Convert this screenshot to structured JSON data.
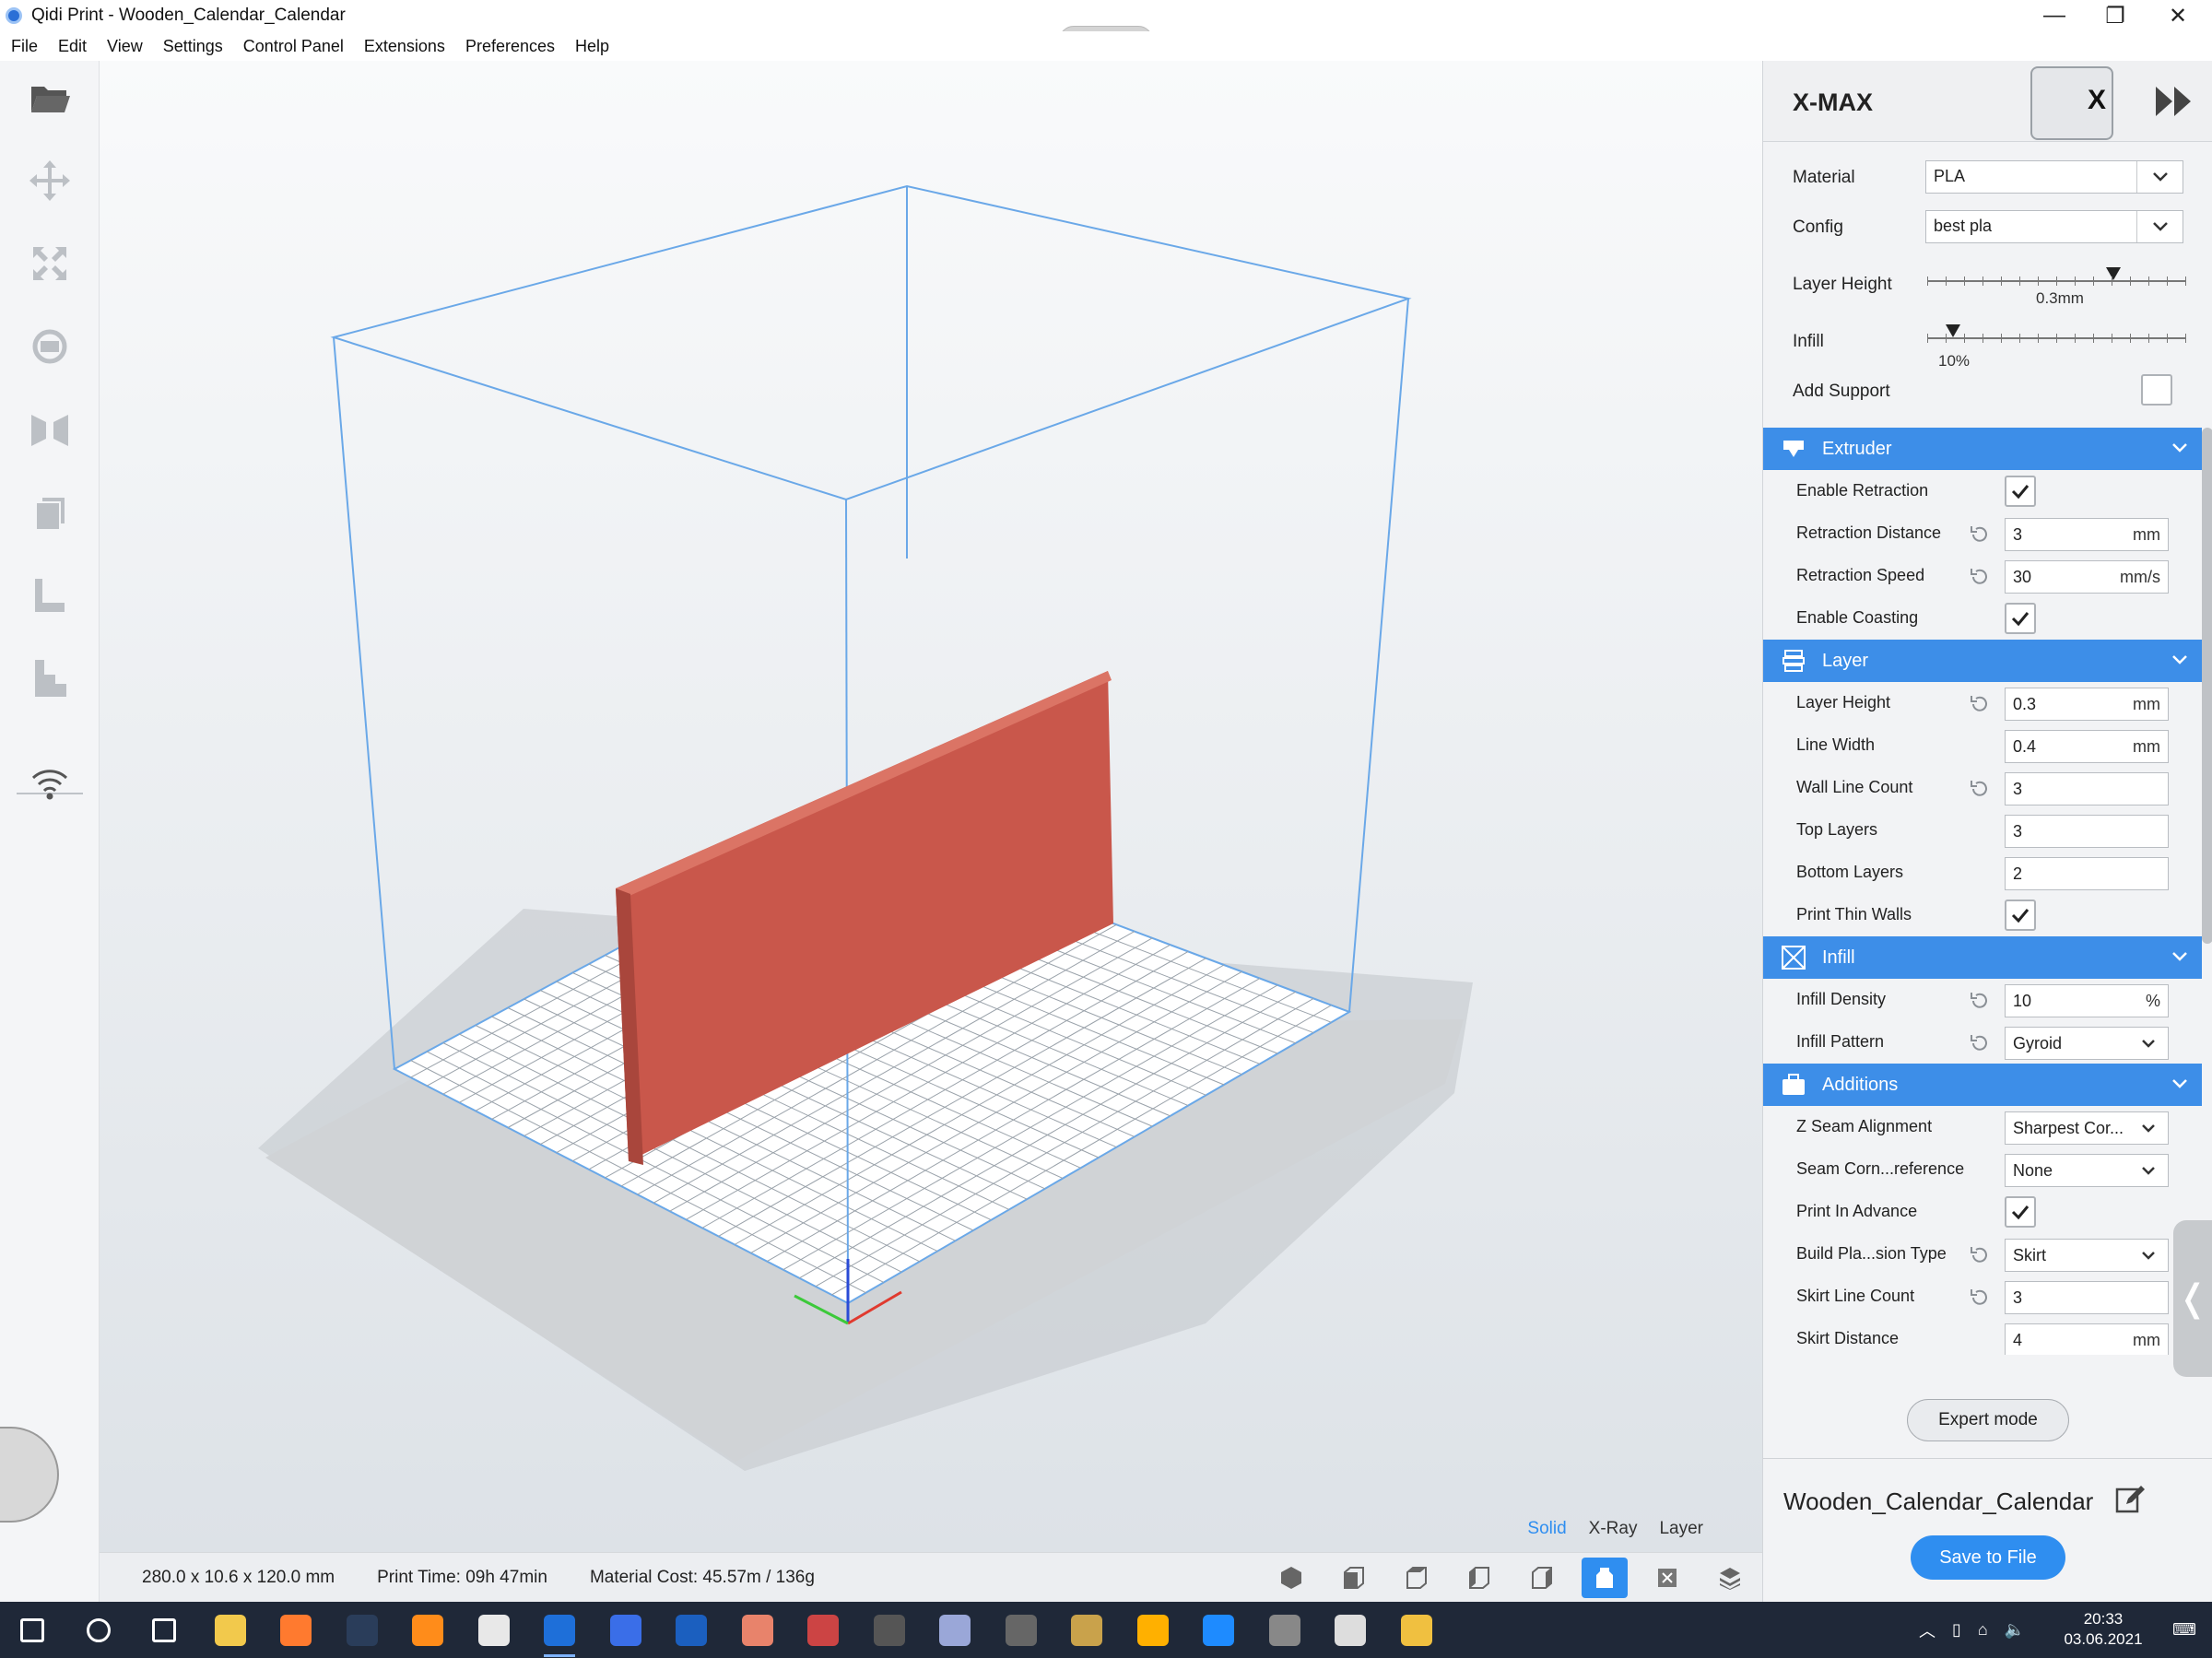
{
  "window": {
    "title": "Qidi Print - Wooden_Calendar_Calendar",
    "controls": {
      "minimize": "—",
      "restore": "❐",
      "close": "✕"
    }
  },
  "menu": [
    "File",
    "Edit",
    "View",
    "Settings",
    "Control Panel",
    "Extensions",
    "Preferences",
    "Help"
  ],
  "left_toolbar": [
    "open-file-icon",
    "move-icon",
    "scale-icon",
    "rotate-icon",
    "mirror-icon",
    "per-model-settings-icon",
    "support-blocker-icon",
    "support-icon",
    "wifi-icon"
  ],
  "viewport": {
    "view_modes": [
      {
        "label": "Solid",
        "active": true
      },
      {
        "label": "X-Ray",
        "active": false
      },
      {
        "label": "Layer",
        "active": false
      }
    ],
    "object_color": "#c9574b",
    "frame_color": "#6aa8e8"
  },
  "status": {
    "dimensions": "280.0 x 10.6 x 120.0 mm",
    "print_time": "Print Time: 09h 47min",
    "material_cost": "Material Cost: 45.57m / 136g"
  },
  "camera_views": [
    "3d-view-icon",
    "front-view-icon",
    "top-view-icon",
    "left-view-icon",
    "right-view-icon",
    "active-view-icon",
    "xray-view-icon",
    "layer-view-icon"
  ],
  "panel": {
    "printer": "X-MAX",
    "printer_badge": "X",
    "material_label": "Material",
    "material_value": "PLA",
    "config_label": "Config",
    "config_value": "best pla",
    "layer_height_label": "Layer Height",
    "layer_height_value": "0.3mm",
    "layer_height_fraction": 0.72,
    "infill_label": "Infill",
    "infill_value": "10%",
    "infill_fraction": 0.1,
    "add_support_label": "Add Support",
    "add_support_checked": false,
    "sections": {
      "extruder": {
        "title": "Extruder",
        "rows": [
          {
            "label": "Enable Retraction",
            "type": "check",
            "checked": true
          },
          {
            "label": "Retraction Distance",
            "type": "input",
            "value": "3",
            "unit": "mm",
            "reset": true
          },
          {
            "label": "Retraction Speed",
            "type": "input",
            "value": "30",
            "unit": "mm/s",
            "reset": true
          },
          {
            "label": "Enable Coasting",
            "type": "check",
            "checked": true
          }
        ]
      },
      "layer": {
        "title": "Layer",
        "rows": [
          {
            "label": "Layer Height",
            "type": "input",
            "value": "0.3",
            "unit": "mm",
            "reset": true
          },
          {
            "label": "Line Width",
            "type": "input",
            "value": "0.4",
            "unit": "mm",
            "reset": false
          },
          {
            "label": "Wall Line Count",
            "type": "input",
            "value": "3",
            "unit": "",
            "reset": true
          },
          {
            "label": "Top Layers",
            "type": "input",
            "value": "3",
            "unit": "",
            "reset": false
          },
          {
            "label": "Bottom Layers",
            "type": "input",
            "value": "2",
            "unit": "",
            "reset": false
          },
          {
            "label": "Print Thin Walls",
            "type": "check",
            "checked": true
          }
        ]
      },
      "infill": {
        "title": "Infill",
        "rows": [
          {
            "label": "Infill Density",
            "type": "input",
            "value": "10",
            "unit": "%",
            "reset": true
          },
          {
            "label": "Infill Pattern",
            "type": "select",
            "value": "Gyroid",
            "reset": true
          }
        ]
      },
      "additions": {
        "title": "Additions",
        "rows": [
          {
            "label": "Z Seam Alignment",
            "type": "select",
            "value": "Sharpest Cor...",
            "reset": false
          },
          {
            "label": "Seam Corn...reference",
            "type": "select",
            "value": "None",
            "reset": false
          },
          {
            "label": "Print In Advance",
            "type": "check",
            "checked": true
          },
          {
            "label": "Build Pla...sion Type",
            "type": "select",
            "value": "Skirt",
            "reset": true
          },
          {
            "label": "Skirt Line Count",
            "type": "input",
            "value": "3",
            "unit": "",
            "reset": true
          },
          {
            "label": "Skirt Distance",
            "type": "input",
            "value": "4",
            "unit": "mm",
            "reset": false
          }
        ]
      }
    },
    "expert_mode": "Expert mode",
    "model_name": "Wooden_Calendar_Calendar",
    "save_button": "Save to File",
    "accent": "#3d8ee8"
  },
  "taskbar": {
    "apps": [
      "windows-start-icon",
      "search-icon",
      "task-view-icon",
      "file-explorer-icon",
      "firefox-icon",
      "steam-icon",
      "blender-icon",
      "xcode-like-icon",
      "qidi-print-icon",
      "visual-studio-icon",
      "powershell-icon",
      "gimp-icon",
      "3d-app-icon",
      "app-m-icon",
      "app-box-icon",
      "app-circle-icon",
      "app-bird-icon",
      "fusion-icon",
      "app-diamond-icon",
      "obs-icon",
      "app-ship-icon",
      "app-arrow-icon"
    ],
    "time": "20:33",
    "date": "03.06.2021"
  }
}
